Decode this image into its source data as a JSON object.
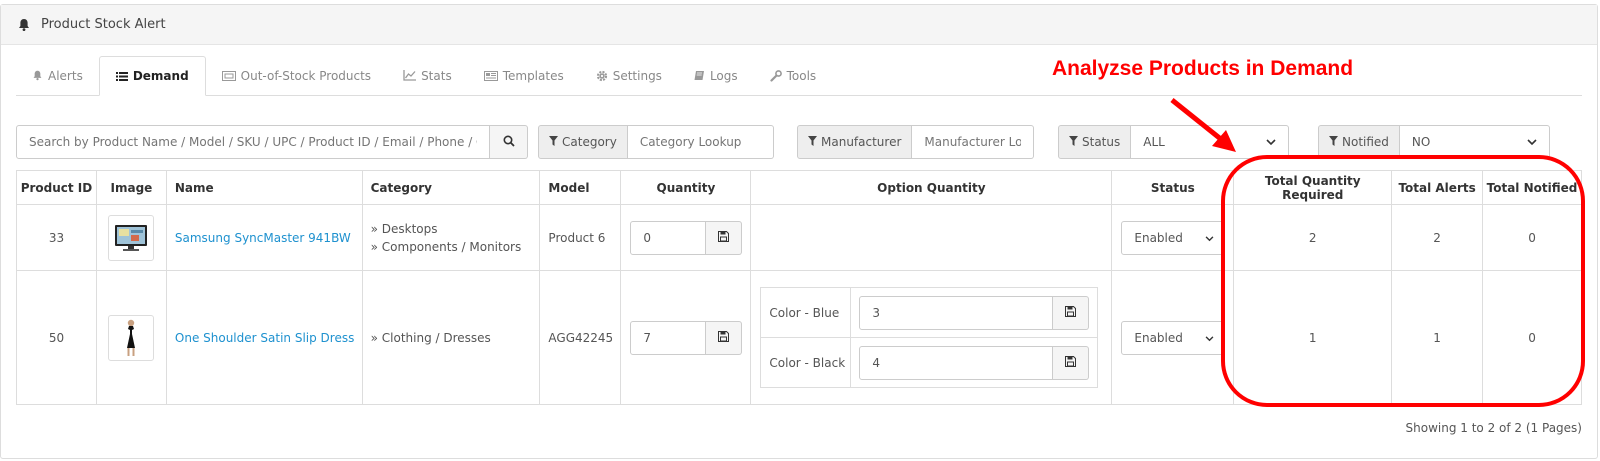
{
  "panel": {
    "title": "Product Stock Alert"
  },
  "tabs": [
    {
      "label": "Alerts",
      "icon": "bell-icon",
      "active": false
    },
    {
      "label": "Demand",
      "icon": "list-icon",
      "active": true
    },
    {
      "label": "Out-of-Stock Products",
      "icon": "ticket-icon",
      "active": false
    },
    {
      "label": "Stats",
      "icon": "chart-icon",
      "active": false
    },
    {
      "label": "Templates",
      "icon": "newspaper-icon",
      "active": false
    },
    {
      "label": "Settings",
      "icon": "gear-icon",
      "active": false
    },
    {
      "label": "Logs",
      "icon": "book-icon",
      "active": false
    },
    {
      "label": "Tools",
      "icon": "wrench-icon",
      "active": false
    }
  ],
  "filters": {
    "search_placeholder": "Search by Product Name / Model / SKU / UPC / Product ID / Email / Phone / Custo",
    "category_label": "Category",
    "category_placeholder": "Category Lookup",
    "manufacturer_label": "Manufacturer",
    "manufacturer_placeholder": "Manufacturer Look",
    "status_label": "Status",
    "status_value": "ALL",
    "notified_label": "Notified",
    "notified_value": "NO"
  },
  "table": {
    "headers": {
      "product_id": "Product ID",
      "image": "Image",
      "name": "Name",
      "category": "Category",
      "model": "Model",
      "quantity": "Quantity",
      "option_quantity": "Option Quantity",
      "status": "Status",
      "total_required": "Total Quantity Required",
      "total_alerts": "Total Alerts",
      "total_notified": "Total Notified"
    },
    "rows": [
      {
        "product_id": "33",
        "name": "Samsung SyncMaster 941BW",
        "categories": [
          "Desktops",
          "Components / Monitors"
        ],
        "model": "Product 6",
        "quantity": "0",
        "options": [],
        "status": "Enabled",
        "total_required": "2",
        "total_alerts": "2",
        "total_notified": "0"
      },
      {
        "product_id": "50",
        "name": "One Shoulder Satin Slip Dress",
        "categories": [
          "Clothing / Dresses"
        ],
        "model": "AGG42245",
        "quantity": "7",
        "options": [
          {
            "label": "Color - Blue",
            "value": "3"
          },
          {
            "label": "Color - Black",
            "value": "4"
          }
        ],
        "status": "Enabled",
        "total_required": "1",
        "total_alerts": "1",
        "total_notified": "0"
      }
    ]
  },
  "footer": {
    "pagination": "Showing 1 to 2 of 2 (1 Pages)"
  },
  "annotation": {
    "text": "Analyzse Products in Demand",
    "color": "#ff0000"
  },
  "colors": {
    "link": "#1e91cf",
    "accent": "#ff0000"
  }
}
